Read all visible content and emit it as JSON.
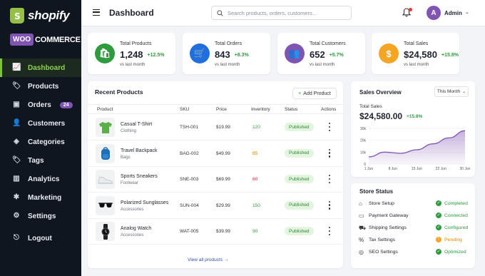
{
  "brand": {
    "shopify": "shopify",
    "woo": "WOO",
    "commerce": "COMMERCE"
  },
  "sidebar": {
    "items": [
      {
        "label": "Dashboard",
        "icon": "chart-up-icon",
        "glyph": "📈",
        "active": true
      },
      {
        "label": "Products",
        "icon": "tag-icon",
        "glyph": "🏷"
      },
      {
        "label": "Orders",
        "icon": "box-icon",
        "glyph": "▣",
        "badge": "24"
      },
      {
        "label": "Customers",
        "icon": "user-icon",
        "glyph": "👤"
      },
      {
        "label": "Categories",
        "icon": "layers-icon",
        "glyph": "◈"
      },
      {
        "label": "Tags",
        "icon": "tags-icon",
        "glyph": "🏷"
      },
      {
        "label": "Analytics",
        "icon": "bar-chart-icon",
        "glyph": "▥"
      },
      {
        "label": "Marketing",
        "icon": "puzzle-icon",
        "glyph": "✱"
      },
      {
        "label": "Settings",
        "icon": "gear-icon",
        "glyph": "⚙"
      }
    ],
    "logout": "Logout"
  },
  "header": {
    "title": "Dashboard",
    "search_placeholder": "Search products, orders, customers...",
    "user_initial": "A",
    "user_name": "Admin"
  },
  "stats": [
    {
      "label": "Total Products",
      "value": "1,248",
      "change": "+12.5%",
      "sub": "vs last month",
      "color": "#2e9b3e",
      "icon": "shopping-bag-icon",
      "glyph": "🛍"
    },
    {
      "label": "Total Orders",
      "value": "843",
      "change": "+8.3%",
      "sub": "vs last month",
      "color": "#1f6fe0",
      "icon": "cart-icon",
      "glyph": "🛒"
    },
    {
      "label": "Total Customers",
      "value": "652",
      "change": "+5.7%",
      "sub": "vs last month",
      "color": "#7f54b3",
      "icon": "users-icon",
      "glyph": "👥"
    },
    {
      "label": "Total Sales",
      "value": "$24,580",
      "change": "+15.8%",
      "sub": "vs last month",
      "color": "#f5a524",
      "icon": "dollar-icon",
      "glyph": "$"
    }
  ],
  "products": {
    "title": "Recent Products",
    "add_label": "Add Product",
    "columns": [
      "Product",
      "SKU",
      "Price",
      "Inventory",
      "Status",
      "Actions"
    ],
    "rows": [
      {
        "name": "Casual T-Shirt",
        "category": "Clothing",
        "sku": "TSH-001",
        "price": "$19.99",
        "inventory": "120",
        "inv_color": "#2e9b3e",
        "status": "Published",
        "thumb": "tshirt"
      },
      {
        "name": "Travel Backpack",
        "category": "Bags",
        "sku": "BAG-002",
        "price": "$49.99",
        "inventory": "85",
        "inv_color": "#e08a00",
        "status": "Published",
        "thumb": "backpack"
      },
      {
        "name": "Sports Sneakers",
        "category": "Footwear",
        "sku": "SNE-003",
        "price": "$69.99",
        "inventory": "60",
        "inv_color": "#d32f2f",
        "status": "Published",
        "thumb": "sneaker"
      },
      {
        "name": "Polarized Sunglasses",
        "category": "Accessories",
        "sku": "SUN-004",
        "price": "$29.99",
        "inventory": "150",
        "inv_color": "#2e9b3e",
        "status": "Published",
        "thumb": "sunglasses"
      },
      {
        "name": "Analog Watch",
        "category": "Accessories",
        "sku": "WAT-005",
        "price": "$39.99",
        "inventory": "90",
        "inv_color": "#2e9b3e",
        "status": "Published",
        "thumb": "watch"
      }
    ],
    "view_all": "View all products →"
  },
  "sales": {
    "title": "Sales Overview",
    "period": "This Month",
    "total_label": "Total Sales",
    "total_value": "$24,580.00",
    "total_change": "+15.8%"
  },
  "chart_data": {
    "type": "area",
    "x": [
      "1 Jun",
      "5 Jun",
      "10 Jun",
      "15 Jun",
      "20 Jun",
      "25 Jun",
      "30 Jun"
    ],
    "xticks": [
      "1 Jun",
      "8 Jun",
      "15 Jun",
      "22 Jun",
      "30 Jun"
    ],
    "values": [
      6,
      10,
      9,
      12,
      17,
      22,
      28
    ],
    "yticks": [
      "0",
      "10k",
      "20k",
      "30k"
    ],
    "ylim": [
      0,
      30000
    ],
    "y_unit": "k",
    "color": "#7f54b3",
    "grid": true
  },
  "store_status": {
    "title": "Store Status",
    "items": [
      {
        "label": "Store Setup",
        "value": "Completed",
        "state": "ok",
        "icon": "store-icon",
        "glyph": "⌂"
      },
      {
        "label": "Payment Gateway",
        "value": "Connected",
        "state": "ok",
        "icon": "credit-card-icon",
        "glyph": "▭"
      },
      {
        "label": "Shipping Settings",
        "value": "Configured",
        "state": "ok",
        "icon": "truck-icon",
        "glyph": "⛟"
      },
      {
        "label": "Tax Settings",
        "value": "Pending",
        "state": "warn",
        "icon": "tax-icon",
        "glyph": "%"
      },
      {
        "label": "SEO Settings",
        "value": "Optimized",
        "state": "ok",
        "icon": "globe-icon",
        "glyph": "◎"
      }
    ]
  }
}
